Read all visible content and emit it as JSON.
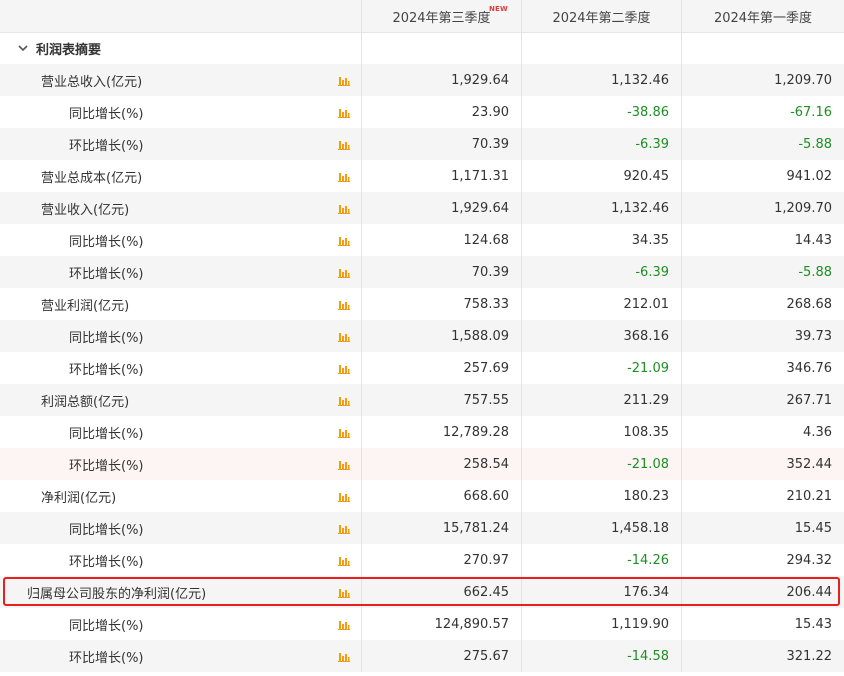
{
  "columns": [
    {
      "label": "2024年第三季度",
      "badge": "NEW"
    },
    {
      "label": "2024年第二季度"
    },
    {
      "label": "2024年第一季度"
    }
  ],
  "section_title": "利润表摘要",
  "icons": {
    "collapse": "chevron-down-icon",
    "row_chart": "bar-chart-icon"
  },
  "colors": {
    "negative": "#1f8e24",
    "chart_icon": "#f39c12",
    "highlight": "#e8201c",
    "badge": "#e03c3c"
  },
  "rows": [
    {
      "label": "营业总收入(亿元)",
      "level": 1,
      "values": [
        "1,929.64",
        "1,132.46",
        "1,209.70"
      ],
      "negative": [
        false,
        false,
        false
      ]
    },
    {
      "label": "同比增长(%)",
      "level": 2,
      "values": [
        "23.90",
        "-38.86",
        "-67.16"
      ],
      "negative": [
        false,
        true,
        true
      ]
    },
    {
      "label": "环比增长(%)",
      "level": 2,
      "values": [
        "70.39",
        "-6.39",
        "-5.88"
      ],
      "negative": [
        false,
        true,
        true
      ]
    },
    {
      "label": "营业总成本(亿元)",
      "level": 1,
      "values": [
        "1,171.31",
        "920.45",
        "941.02"
      ],
      "negative": [
        false,
        false,
        false
      ]
    },
    {
      "label": "营业收入(亿元)",
      "level": 1,
      "values": [
        "1,929.64",
        "1,132.46",
        "1,209.70"
      ],
      "negative": [
        false,
        false,
        false
      ]
    },
    {
      "label": "同比增长(%)",
      "level": 2,
      "values": [
        "124.68",
        "34.35",
        "14.43"
      ],
      "negative": [
        false,
        false,
        false
      ]
    },
    {
      "label": "环比增长(%)",
      "level": 2,
      "values": [
        "70.39",
        "-6.39",
        "-5.88"
      ],
      "negative": [
        false,
        true,
        true
      ]
    },
    {
      "label": "营业利润(亿元)",
      "level": 1,
      "values": [
        "758.33",
        "212.01",
        "268.68"
      ],
      "negative": [
        false,
        false,
        false
      ]
    },
    {
      "label": "同比增长(%)",
      "level": 2,
      "values": [
        "1,588.09",
        "368.16",
        "39.73"
      ],
      "negative": [
        false,
        false,
        false
      ]
    },
    {
      "label": "环比增长(%)",
      "level": 2,
      "values": [
        "257.69",
        "-21.09",
        "346.76"
      ],
      "negative": [
        false,
        true,
        false
      ]
    },
    {
      "label": "利润总额(亿元)",
      "level": 1,
      "values": [
        "757.55",
        "211.29",
        "267.71"
      ],
      "negative": [
        false,
        false,
        false
      ]
    },
    {
      "label": "同比增长(%)",
      "level": 2,
      "values": [
        "12,789.28",
        "108.35",
        "4.36"
      ],
      "negative": [
        false,
        false,
        false
      ]
    },
    {
      "label": "环比增长(%)",
      "level": 2,
      "values": [
        "258.54",
        "-21.08",
        "352.44"
      ],
      "negative": [
        false,
        true,
        false
      ],
      "hover": true
    },
    {
      "label": "净利润(亿元)",
      "level": 1,
      "values": [
        "668.60",
        "180.23",
        "210.21"
      ],
      "negative": [
        false,
        false,
        false
      ]
    },
    {
      "label": "同比增长(%)",
      "level": 2,
      "values": [
        "15,781.24",
        "1,458.18",
        "15.45"
      ],
      "negative": [
        false,
        false,
        false
      ]
    },
    {
      "label": "环比增长(%)",
      "level": 2,
      "values": [
        "270.97",
        "-14.26",
        "294.32"
      ],
      "negative": [
        false,
        true,
        false
      ]
    },
    {
      "label": "归属母公司股东的净利润(亿元)",
      "level": 0,
      "values": [
        "662.45",
        "176.34",
        "206.44"
      ],
      "negative": [
        false,
        false,
        false
      ],
      "highlighted": true
    },
    {
      "label": "同比增长(%)",
      "level": 2,
      "values": [
        "124,890.57",
        "1,119.90",
        "15.43"
      ],
      "negative": [
        false,
        false,
        false
      ]
    },
    {
      "label": "环比增长(%)",
      "level": 2,
      "values": [
        "275.67",
        "-14.58",
        "321.22"
      ],
      "negative": [
        false,
        true,
        false
      ]
    }
  ]
}
